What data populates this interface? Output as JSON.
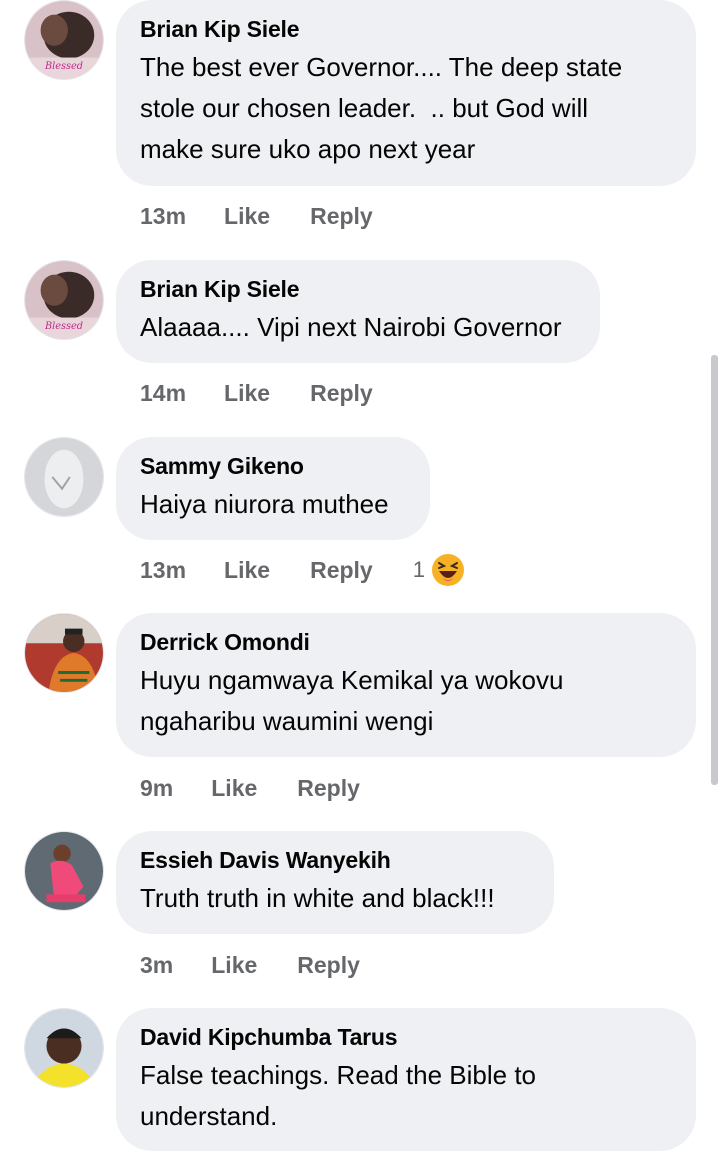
{
  "comments": [
    {
      "author": "Brian Kip Siele",
      "text": "The best ever Governor.... The deep state\nstole our chosen leader.  .. but God will\nmake sure uko apo next year",
      "time": "13m",
      "like": "Like",
      "reply": "Reply",
      "avatar_label": "Blessed"
    },
    {
      "author": "Brian Kip Siele",
      "text": "Alaaaa.... Vipi next Nairobi Governor",
      "time": "14m",
      "like": "Like",
      "reply": "Reply",
      "avatar_label": "Blessed"
    },
    {
      "author": "Sammy Gikeno",
      "text": "Haiya niurora muthee",
      "time": "13m",
      "like": "Like",
      "reply": "Reply",
      "reaction_count": "1",
      "reaction_icon": "haha-emoji-icon"
    },
    {
      "author": "Derrick Omondi",
      "text": "Huyu ngamwaya Kemikal ya wokovu\nngaharibu waumini wengi",
      "time": "9m",
      "like": "Like",
      "reply": "Reply"
    },
    {
      "author": "Essieh Davis Wanyekih",
      "text": "Truth truth in white and black!!!",
      "time": "3m",
      "like": "Like",
      "reply": "Reply"
    },
    {
      "author": "David Kipchumba Tarus",
      "text": "False teachings. Read the Bible to\nunderstand."
    }
  ],
  "colors": {
    "bubble": "#eff0f3",
    "meta": "#65676b",
    "text": "#050505",
    "emoji": "#f7b125"
  }
}
